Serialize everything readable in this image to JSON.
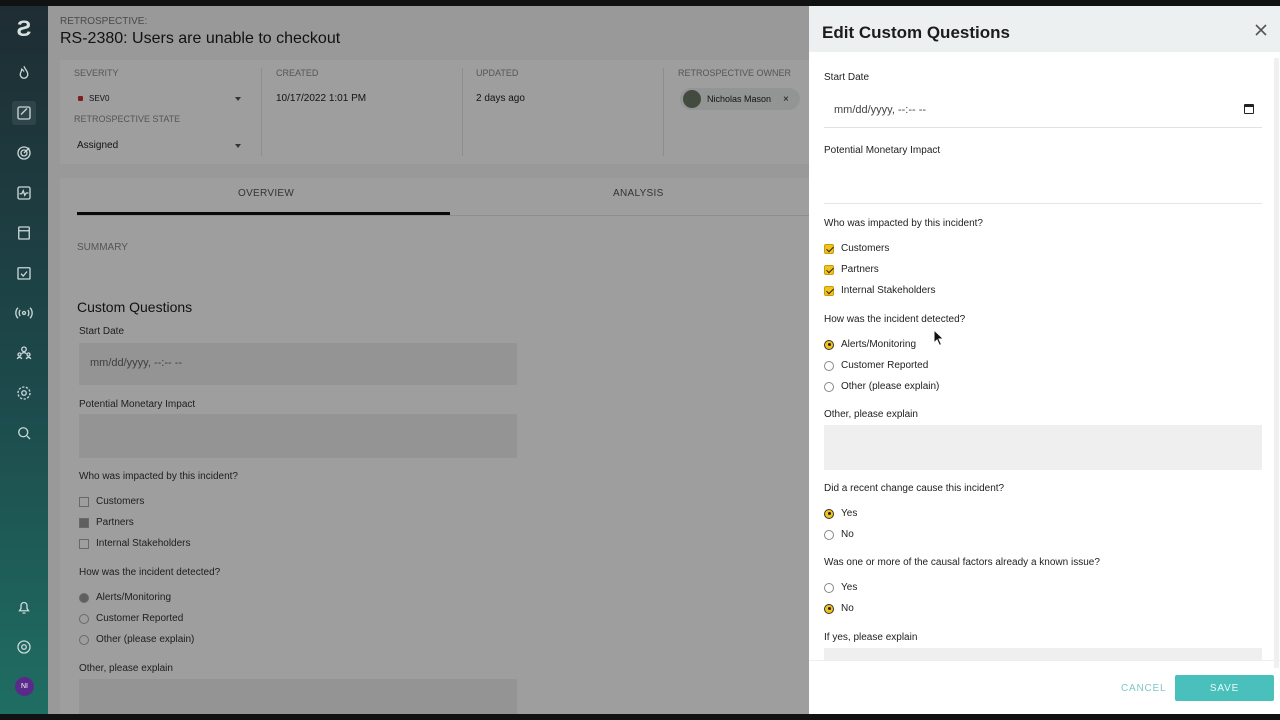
{
  "retro": {
    "label": "RETROSPECTIVE:",
    "title": "RS-2380: Users are unable to checkout"
  },
  "meta": {
    "severity_label": "SEVERITY",
    "severity_value": "SEV0",
    "state_label": "RETROSPECTIVE STATE",
    "state_value": "Assigned",
    "created_label": "CREATED",
    "created_value": "10/17/2022 1:01 PM",
    "updated_label": "UPDATED",
    "updated_value": "2 days ago",
    "owner_label": "RETROSPECTIVE OWNER",
    "owner_value": "Nicholas Mason",
    "owner_remove": "×"
  },
  "tabs": {
    "overview": "OVERVIEW",
    "analysis": "ANALYSIS"
  },
  "summary_label": "SUMMARY",
  "background": {
    "title": "Custom Questions",
    "start_date_label": "Start Date",
    "start_date_placeholder": "mm/dd/yyyy, --:-- --",
    "monetary_label": "Potential Monetary Impact",
    "impacted_label": "Who was impacted by this incident?",
    "impacted_options": [
      "Customers",
      "Partners",
      "Internal Stakeholders"
    ],
    "detected_label": "How was the incident detected?",
    "detected_options": [
      "Alerts/Monitoring",
      "Customer Reported",
      "Other (please explain)"
    ],
    "other_label": "Other, please explain"
  },
  "sidebar": {
    "avatar_initials": "NI"
  },
  "drawer": {
    "title": "Edit Custom Questions",
    "start_date_label": "Start Date",
    "start_date_placeholder": "mm/dd/yyyy, --:-- --",
    "monetary_label": "Potential Monetary Impact",
    "impacted_label": "Who was impacted by this incident?",
    "impacted_options": [
      "Customers",
      "Partners",
      "Internal Stakeholders"
    ],
    "detected_label": "How was the incident detected?",
    "detected_options": [
      "Alerts/Monitoring",
      "Customer Reported",
      "Other (please explain)"
    ],
    "detected_selected": "Alerts/Monitoring",
    "other_label": "Other, please explain",
    "recent_change_label": "Did a recent change cause this incident?",
    "recent_change_options": [
      "Yes",
      "No"
    ],
    "recent_change_selected": "Yes",
    "known_issue_label": "Was one or more of the causal factors already a known issue?",
    "known_issue_options": [
      "Yes",
      "No"
    ],
    "known_issue_selected": "No",
    "if_yes_label": "If yes, please explain",
    "cancel_label": "CANCEL",
    "save_label": "SAVE"
  },
  "colors": {
    "accent": "#49c0bc",
    "checkbox": "#f2c318",
    "sidebar_top": "#1e2d33",
    "sidebar_bottom": "#1f6e63"
  }
}
